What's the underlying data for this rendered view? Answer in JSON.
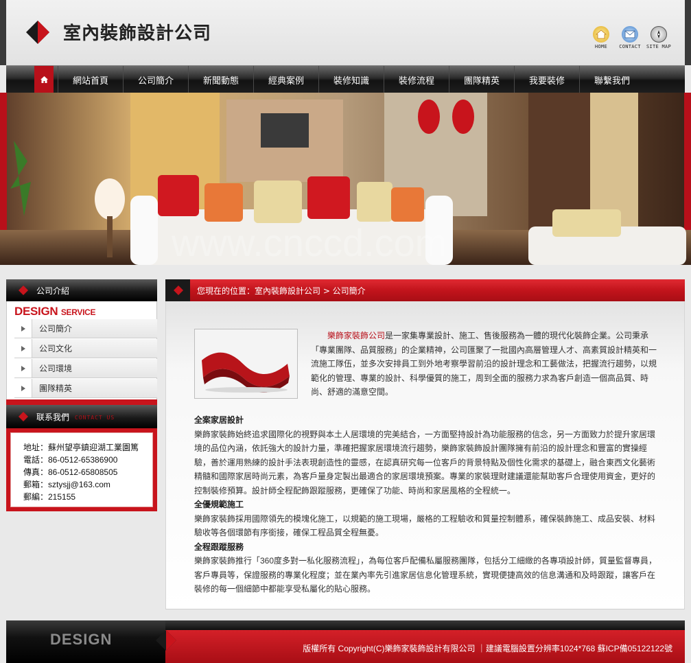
{
  "header": {
    "logo_text": "室內裝飾設計公司",
    "quick_links": [
      {
        "label": "HOME",
        "icon": "home-icon"
      },
      {
        "label": "CONTACT",
        "icon": "mail-icon"
      },
      {
        "label": "SITE MAP",
        "icon": "compass-icon"
      }
    ]
  },
  "nav": {
    "items": [
      "網站首頁",
      "公司簡介",
      "新聞動態",
      "經典案例",
      "裝修知識",
      "裝修流程",
      "團隊精英",
      "我要裝修",
      "聯繫我們"
    ]
  },
  "banner": {
    "watermark": "www.cnccd.com"
  },
  "sidebar": {
    "about_title": "公司介紹",
    "design_service": "DESIGN",
    "design_service_sub": "SERVICE",
    "items": [
      "公司簡介",
      "公司文化",
      "公司環境",
      "團隊精英"
    ],
    "contact_title": "联系我們",
    "contact_title_en": "CONTACT US",
    "contact_lines": [
      "地址：蘇州望亭鎮迎湖工業園篤",
      "電話：86-0512-65386900",
      "傳真：86-0512-65808505",
      "郵箱：sztysjj@163.com",
      "郵編：215155"
    ]
  },
  "main": {
    "breadcrumb": "您現在的位置：室內裝飾設計公司 > 公司簡介",
    "intro_brand": "樂飾家裝飾公司",
    "intro_rest": "是一家集專業設計、施工、售後服務為一體的現代化裝飾企業。公司秉承「專業團隊、品質服務」的企業精神，公司匯聚了一批國內高層管理人才、高素質設計精英和一流施工隊伍，並多次安排員工到外地考察學習前沿的設計理念和工藝做法，把握流行趨勢，以規範化的管理、專業的設計、科學優質的施工，周到全面的服務力求為客戶創造一個高品質、時尚、舒適的滿意空間。",
    "sections": [
      {
        "title": "全案家居設計",
        "text": "樂飾家裝飾始終追求國際化的視野與本土人居環境的完美結合，一方面堅持設計為功能服務的信念，另一方面致力於提升家居環境的品位內涵，依託強大的設計力量，準確把握家居環境流行趨勢，樂飾家裝飾設計團隊擁有前沿的設計理念和豐富的實操經驗，善於運用熟練的設計手法表現創造性的靈感，在認真研究每一位客戶的背景特點及個性化需求的基礎上，融合東西文化藝術精髓和國際家居時尚元素，為客戶量身定製出最適合的家居環境預案。專業的家裝理財建議還能幫助客戶合理使用資金，更好的控制裝修預算。設計師全程配飾跟蹤服務，更確保了功能、時尚和家居風格的全程統一。"
      },
      {
        "title": "全優規範施工",
        "text": "樂飾家裝飾採用國際領先的模塊化施工，以規範的施工現場，嚴格的工程驗收和質量控制體系，確保裝飾施工、成品安裝、材料驗收等各個環節有序銜接，確保工程品質全程無憂。"
      },
      {
        "title": "全程跟蹤服務",
        "text": "樂飾家裝飾推行「360度多對一私化服務流程」，為每位客戶配備私屬服務團隊，包括分工細緻的各專項設計師，質量監督專員，客戶專員等，保證服務的專業化程度；並在業內率先引進家居信息化管理系統，實現便捷高效的信息溝通和及時跟蹤，讓客戶在裝修的每一個細節中都能享受私屬化的貼心服務。"
      }
    ]
  },
  "footer": {
    "design_word": "DESIGN",
    "copyright": "版權所有 Copyright(C)樂飾家裝飾設計有限公司 ｜建議電腦設置分辨率1024*768 蘇ICP備05122122號"
  },
  "colors": {
    "accent": "#c8141c",
    "dark": "#1a1a1a"
  }
}
